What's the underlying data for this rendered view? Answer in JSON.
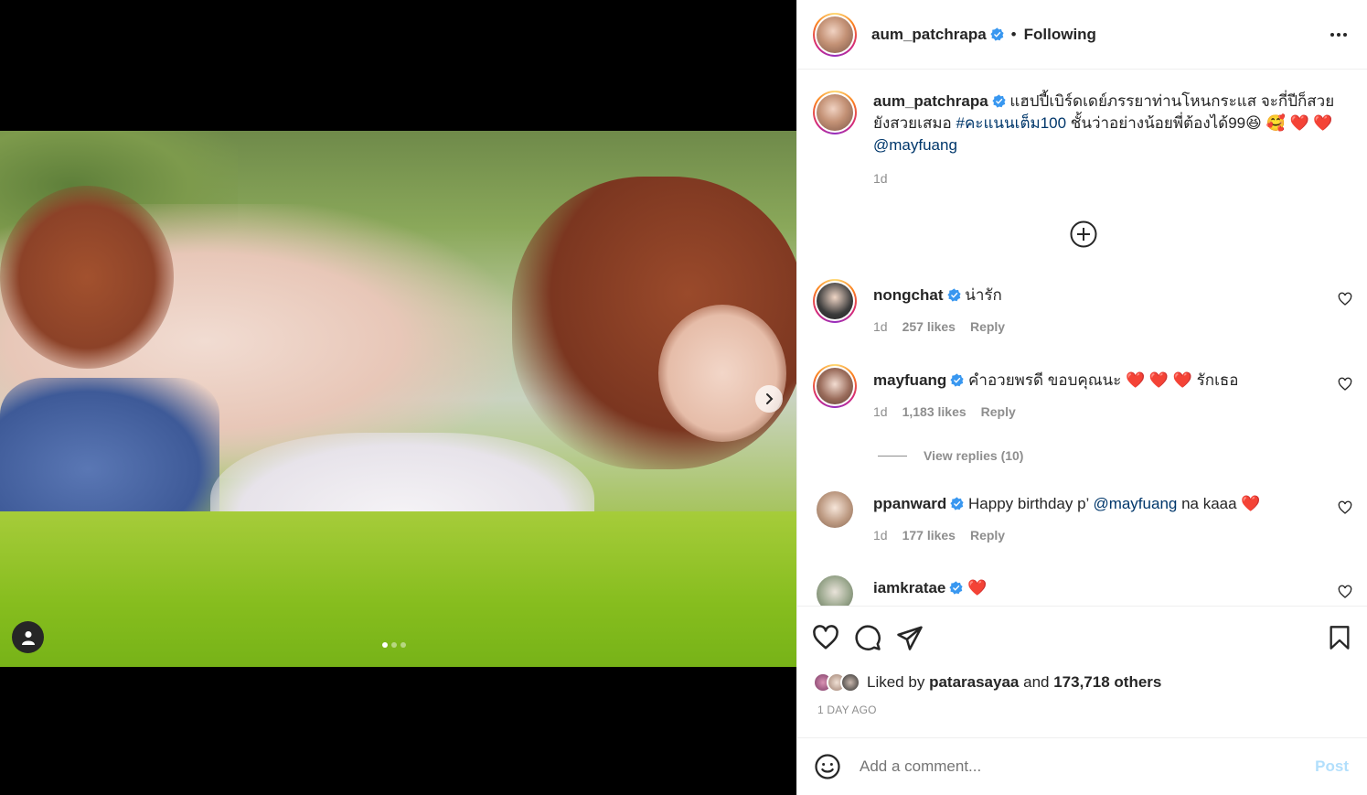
{
  "post": {
    "author": "aum_patchrapa",
    "follow_status": "Following",
    "bullet": "•"
  },
  "caption": {
    "username": "aum_patchrapa",
    "text_part1": "แฮปปี้เบิร์ดเดย์ภรรยาท่านโหนกระแส จะกี่ปีก็สวยยังสวยเสมอ",
    "hashtag": "#คะแนนเต็ม100",
    "text_part2": "ชั้นว่าอย่างน้อยพี่ต้องได้99😆 🥰 ❤️ ❤️",
    "mention": "@mayfuang",
    "time": "1d"
  },
  "comments": [
    {
      "username": "nongchat",
      "text": "น่ารัก",
      "time": "1d",
      "likes": "257 likes",
      "reply": "Reply"
    },
    {
      "username": "mayfuang",
      "text": "คำอวยพรดี ขอบคุณนะ ❤️ ❤️ ❤️ รักเธอ",
      "time": "1d",
      "likes": "1,183 likes",
      "reply": "Reply",
      "view_replies": "View replies (10)"
    },
    {
      "username": "ppanward",
      "text_before": "Happy birthday p’",
      "mention": "@mayfuang",
      "text_after": "na kaaa ❤️",
      "time": "1d",
      "likes": "177 likes",
      "reply": "Reply"
    },
    {
      "username": "iamkratae",
      "text": "❤️"
    }
  ],
  "likes": {
    "prefix": "Liked by",
    "user": "patarasayaa",
    "middle": "and",
    "others": "173,718 others"
  },
  "timestamp": "1 DAY AGO",
  "add_comment": {
    "placeholder": "Add a comment...",
    "post_label": "Post"
  },
  "colors": {
    "link": "#00376b",
    "verified": "#3897f0",
    "heart": "#ed2b2b",
    "post_disabled": "#b2dffc"
  },
  "carousel": {
    "count": 3,
    "active": 1
  }
}
